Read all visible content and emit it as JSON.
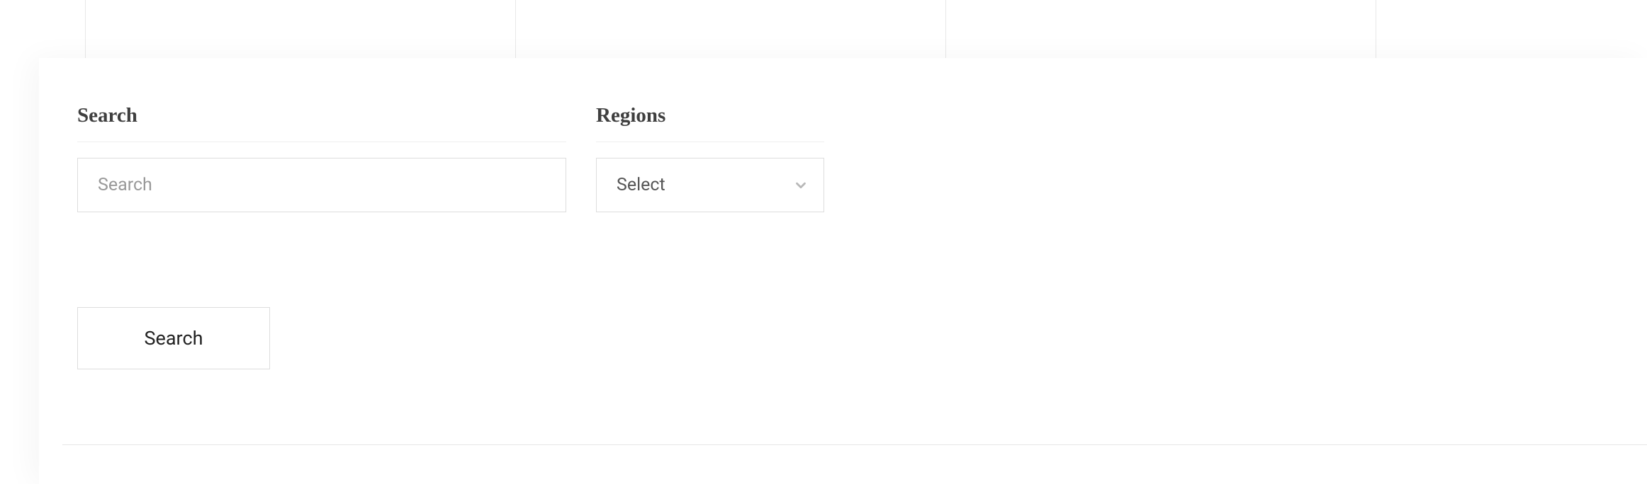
{
  "filters": {
    "search": {
      "label": "Search",
      "placeholder": "Search",
      "value": ""
    },
    "regions": {
      "label": "Regions",
      "selected": "Select"
    }
  },
  "actions": {
    "search_button_label": "Search"
  }
}
